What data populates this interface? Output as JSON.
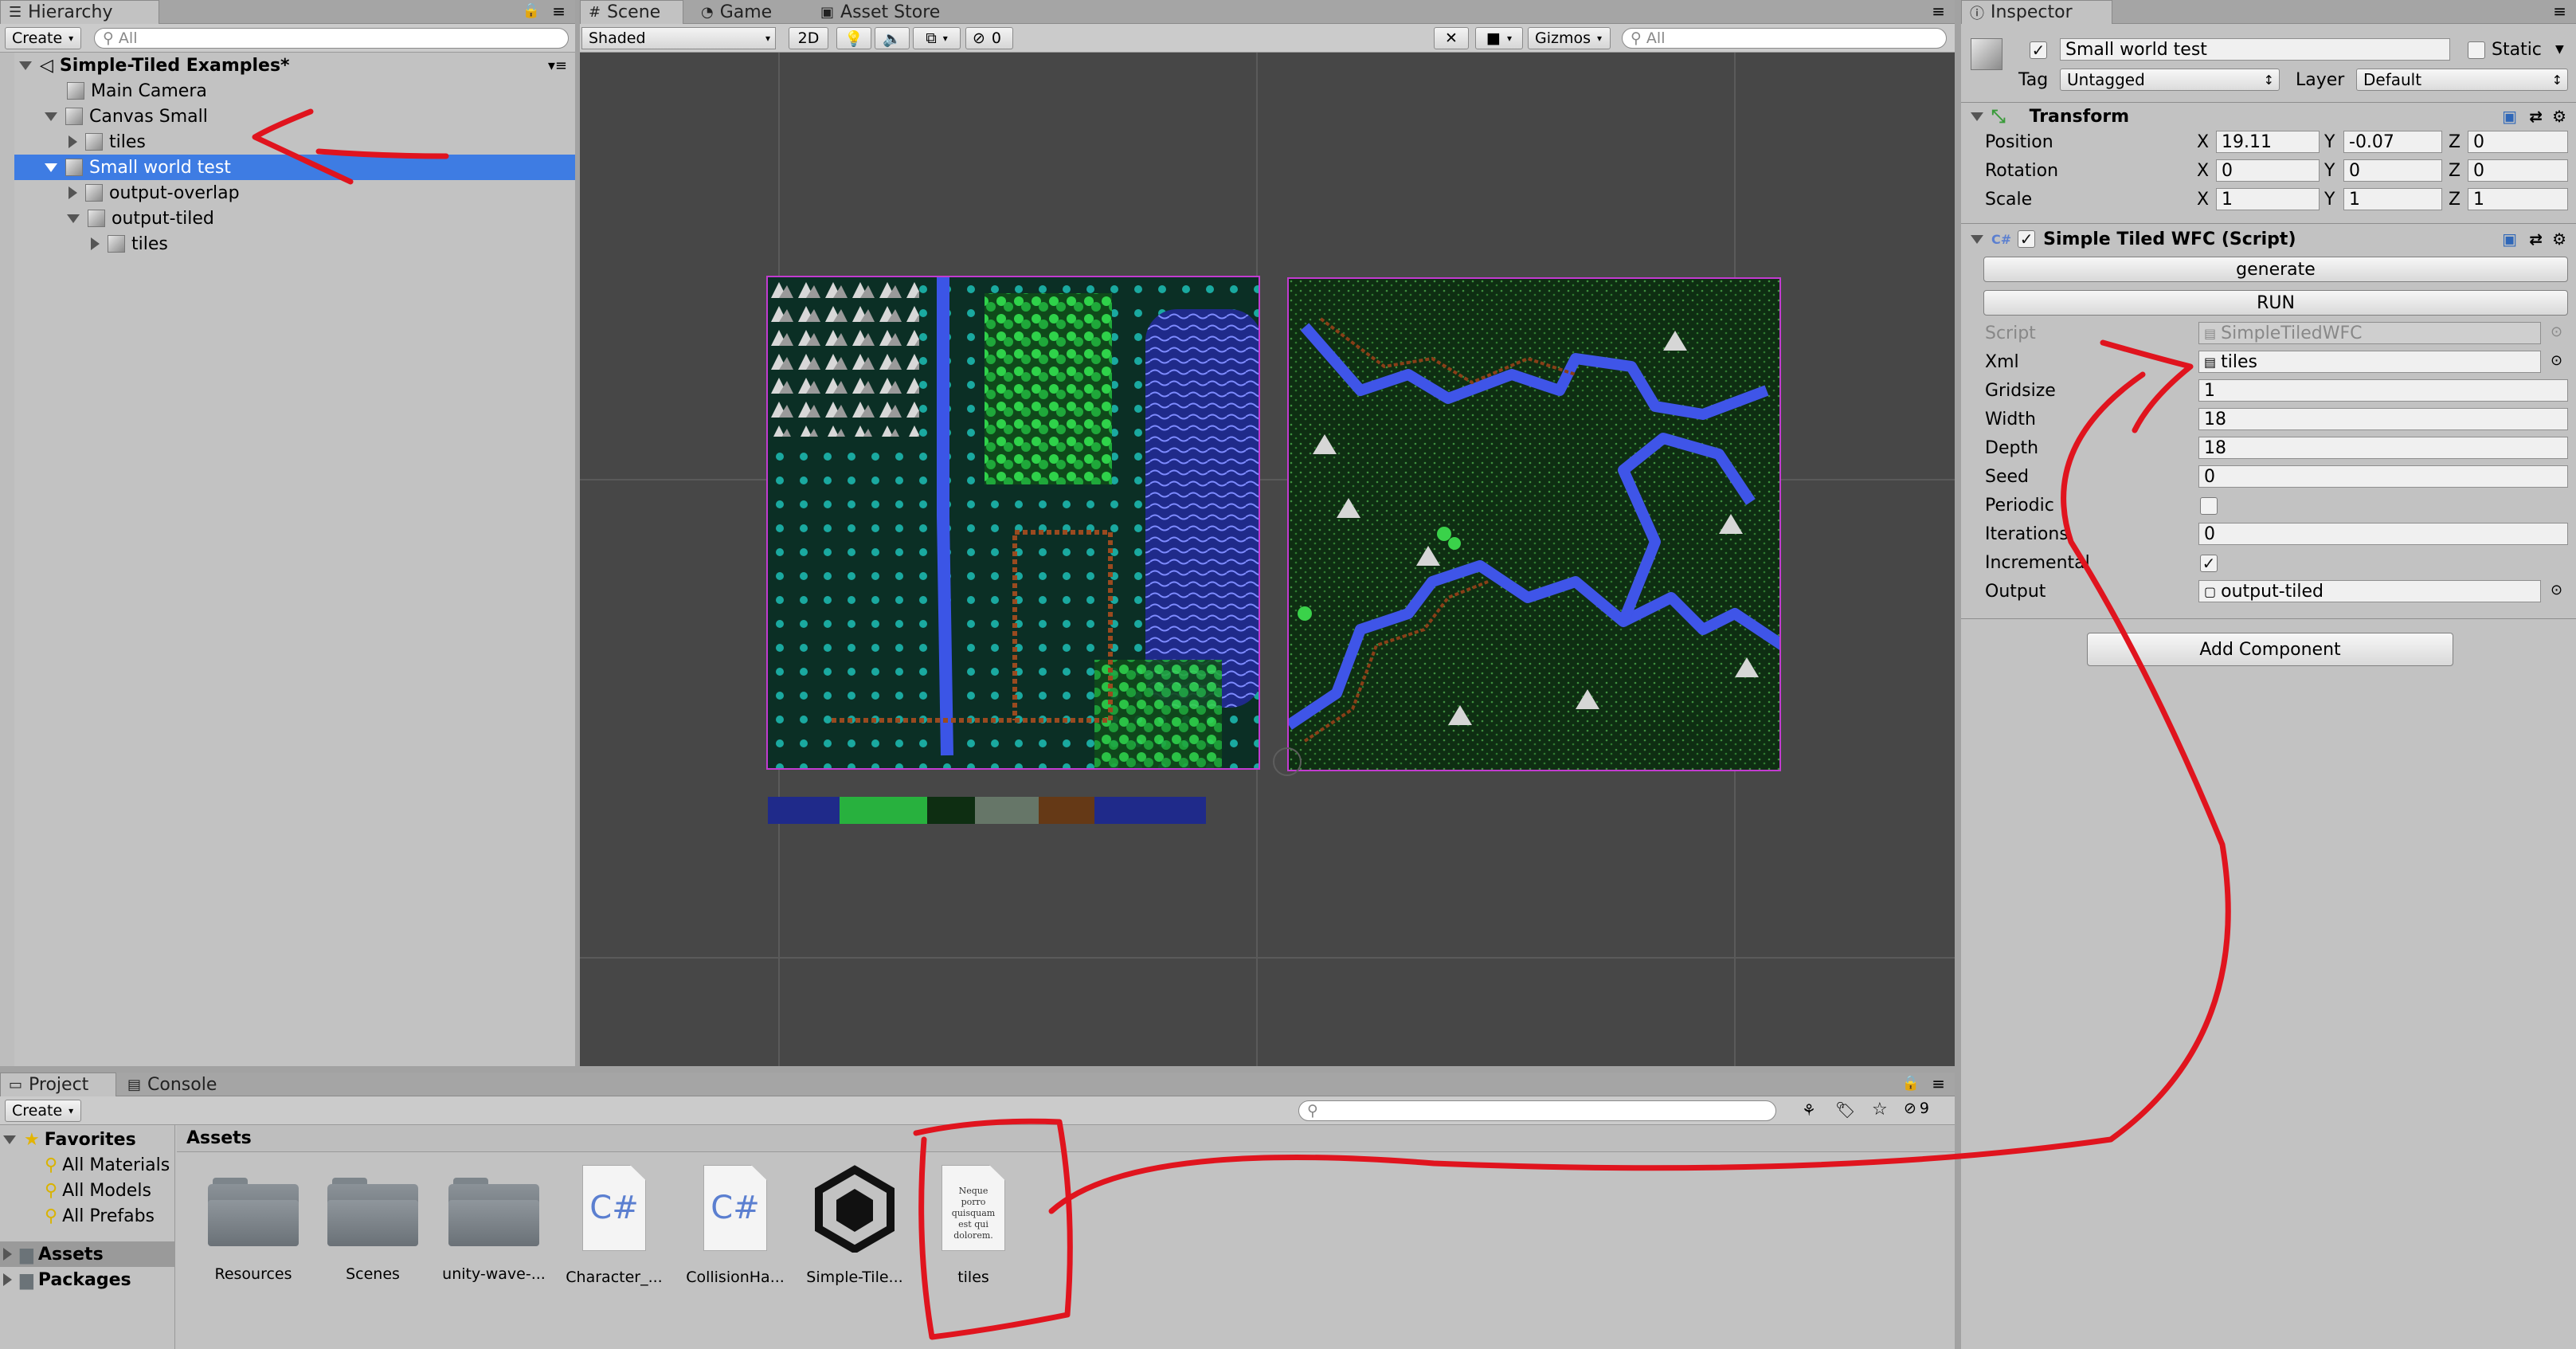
{
  "hierarchy": {
    "tab_label": "Hierarchy",
    "create_label": "Create",
    "search_placeholder": "All",
    "scene_name": "Simple-Tiled Examples*",
    "items": [
      {
        "label": "Main Camera"
      },
      {
        "label": "Canvas Small"
      },
      {
        "label": "tiles"
      },
      {
        "label": "Small world test"
      },
      {
        "label": "output-overlap"
      },
      {
        "label": "output-tiled"
      },
      {
        "label": "tiles"
      }
    ]
  },
  "scene_view": {
    "tabs": [
      {
        "label": "Scene"
      },
      {
        "label": "Game"
      },
      {
        "label": "Asset Store"
      }
    ],
    "shading_mode": "Shaded",
    "mode_2d": "2D",
    "hidden_count": "0",
    "gizmos_label": "Gizmos",
    "search_placeholder": "All"
  },
  "inspector": {
    "tab_label": "Inspector",
    "object_name": "Small world test",
    "static_label": "Static",
    "tag_label": "Tag",
    "tag_value": "Untagged",
    "layer_label": "Layer",
    "layer_value": "Default",
    "transform": {
      "title": "Transform",
      "rows": [
        {
          "label": "Position",
          "x": "19.11",
          "y": "-0.07",
          "z": "0"
        },
        {
          "label": "Rotation",
          "x": "0",
          "y": "0",
          "z": "0"
        },
        {
          "label": "Scale",
          "x": "1",
          "y": "1",
          "z": "1"
        }
      ],
      "axis_x": "X",
      "axis_y": "Y",
      "axis_z": "Z"
    },
    "script_component": {
      "title": "Simple Tiled WFC (Script)",
      "generate_label": "generate",
      "run_label": "RUN",
      "fields": {
        "script_label": "Script",
        "script_value": "SimpleTiledWFC",
        "xml_label": "Xml",
        "xml_value": "tiles",
        "gridsize_label": "Gridsize",
        "gridsize_value": "1",
        "width_label": "Width",
        "width_value": "18",
        "depth_label": "Depth",
        "depth_value": "18",
        "seed_label": "Seed",
        "seed_value": "0",
        "periodic_label": "Periodic",
        "iterations_label": "Iterations",
        "iterations_value": "0",
        "incremental_label": "Incremental",
        "output_label": "Output",
        "output_value": "output-tiled"
      },
      "periodic_checked": false,
      "incremental_checked": true
    },
    "add_component_label": "Add Component"
  },
  "project": {
    "tabs": [
      {
        "label": "Project"
      },
      {
        "label": "Console"
      }
    ],
    "create_label": "Create",
    "hidden_count": "9",
    "favorites_label": "Favorites",
    "favorites": [
      {
        "label": "All Materials"
      },
      {
        "label": "All Models"
      },
      {
        "label": "All Prefabs"
      }
    ],
    "assets_label": "Assets",
    "packages_label": "Packages",
    "breadcrumb": "Assets",
    "assets": [
      {
        "label": "Resources",
        "kind": "folder"
      },
      {
        "label": "Scenes",
        "kind": "folder"
      },
      {
        "label": "unity-wave-...",
        "kind": "folder"
      },
      {
        "label": "Character_...",
        "kind": "csharp"
      },
      {
        "label": "CollisionHa...",
        "kind": "csharp"
      },
      {
        "label": "Simple-Tile...",
        "kind": "unity"
      },
      {
        "label": "tiles",
        "kind": "text"
      }
    ],
    "text_asset_preview": "Neque porro quisquam est qui dolorem."
  },
  "colors": {
    "selection": "#3e7ce3",
    "annotation_red": "#e0141e",
    "tile_border": "#c23bd0"
  }
}
